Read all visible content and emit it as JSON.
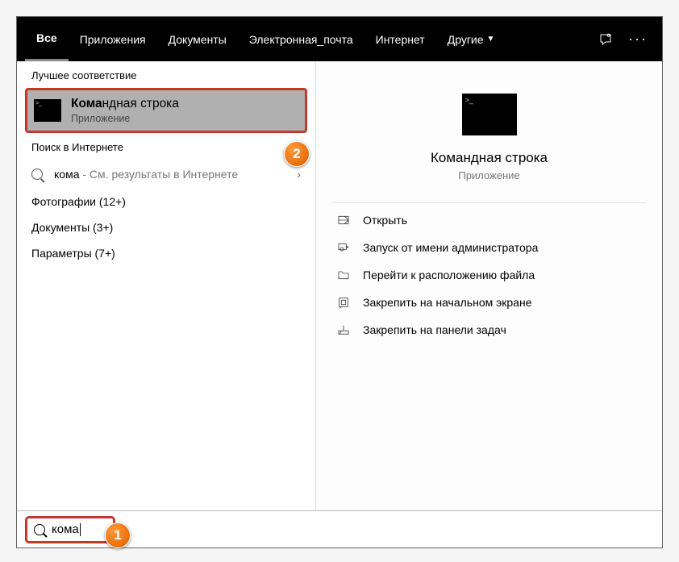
{
  "tabs": {
    "all": "Все",
    "apps": "Приложения",
    "docs": "Документы",
    "email": "Электронная_почта",
    "internet": "Интернет",
    "other": "Другие"
  },
  "left": {
    "best_match_header": "Лучшее соответствие",
    "best_title_bold": "Кома",
    "best_title_rest": "ндная строка",
    "best_sub": "Приложение",
    "web_header": "Поиск в Интернете",
    "web_query": "кома",
    "web_hint": " - См. результаты в Интернете",
    "cat_photos": "Фотографии (12+)",
    "cat_docs": "Документы (3+)",
    "cat_params": "Параметры (7+)"
  },
  "right": {
    "title": "Командная строка",
    "sub": "Приложение",
    "actions": {
      "open": "Открыть",
      "run_admin": "Запуск от имени администратора",
      "goto_file": "Перейти к расположению файла",
      "pin_start": "Закрепить на начальном экране",
      "pin_taskbar": "Закрепить на панели задач"
    }
  },
  "search": {
    "value": "кома"
  },
  "callouts": {
    "one": "1",
    "two": "2"
  }
}
